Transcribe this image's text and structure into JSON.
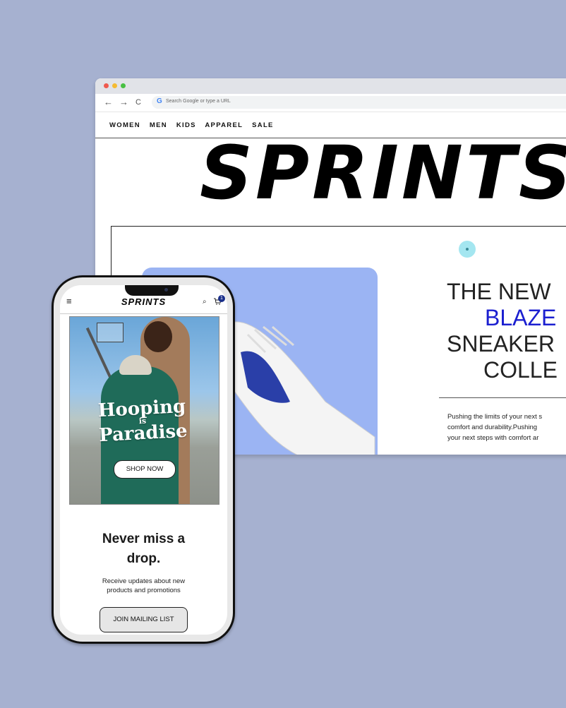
{
  "browser": {
    "nav_back": "←",
    "nav_forward": "→",
    "nav_reload": "C",
    "url_logo": "G",
    "url_placeholder": "Search Google or type a URL"
  },
  "site": {
    "nav": [
      "WOMEN",
      "MEN",
      "KIDS",
      "APPAREL",
      "SALE"
    ],
    "brand": "SPRINTS",
    "headline": [
      "THE NEW",
      "BLAZE",
      "SNEAKER",
      "COLLE"
    ],
    "copy": [
      "Pushing the limits of your next s",
      "comfort and durability.Pushing",
      "your next steps with comfort ar"
    ],
    "accent_color": "#1b1fd0"
  },
  "phone": {
    "brand": "SPRINTS",
    "menu_icon": "≡",
    "search_icon": "⌕",
    "cart_icon": "🛒",
    "cart_count": "1",
    "hero_text": [
      "Hooping",
      "is",
      "Paradise"
    ],
    "shop_now": "SHOP NOW",
    "title": [
      "Never miss a",
      "drop."
    ],
    "subtitle": [
      "Receive updates about new",
      "products and promotions"
    ],
    "join_button": "JOIN MAILING LIST"
  }
}
